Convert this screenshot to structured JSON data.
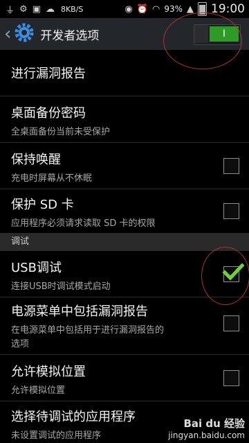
{
  "status_bar": {
    "icons": [
      "usb-icon",
      "android-debug-icon",
      "image-icon",
      "cloud-icon",
      "eye-icon",
      "alarm-icon",
      "wifi-icon",
      "signal-icon",
      "battery-icon"
    ],
    "speed": "8KB/S",
    "battery": "93%",
    "time": "19:00"
  },
  "action_bar": {
    "title": "开发者选项",
    "switch_label": "I",
    "switch_on": true
  },
  "items": [
    {
      "title": "进行漏洞报告"
    },
    {
      "title": "桌面备份密码",
      "subtitle": "全桌面备份当前未受保护"
    },
    {
      "title": "保持唤醒",
      "subtitle": "充电时屏幕从不休眠",
      "checked": false
    },
    {
      "title": "保护 SD 卡",
      "subtitle": "应用程序必须请求读取 SD 卡的权限",
      "checked": false
    }
  ],
  "section_debug": "调试",
  "debug_items": [
    {
      "title": "USB调试",
      "subtitle": "连接USB时调试模式启动",
      "checked": true
    },
    {
      "title": "电源菜单中包括漏洞报告",
      "subtitle_line1": "在电源菜单中包括用于进行漏洞报告的",
      "subtitle_line2": "选项",
      "checked": false
    },
    {
      "title": "允许模拟位置",
      "subtitle": "允许模拟位置",
      "checked": false
    },
    {
      "title": "选择待调试的应用程序",
      "subtitle": "未设置调试的应用程序"
    }
  ],
  "watermark": {
    "logo": "Bai du 经验",
    "url": "jingyan.baidu.com"
  },
  "colors": {
    "accent_green": "#2f9b27",
    "check_green": "#6fcf3c",
    "annotation_red": "#b03030"
  }
}
